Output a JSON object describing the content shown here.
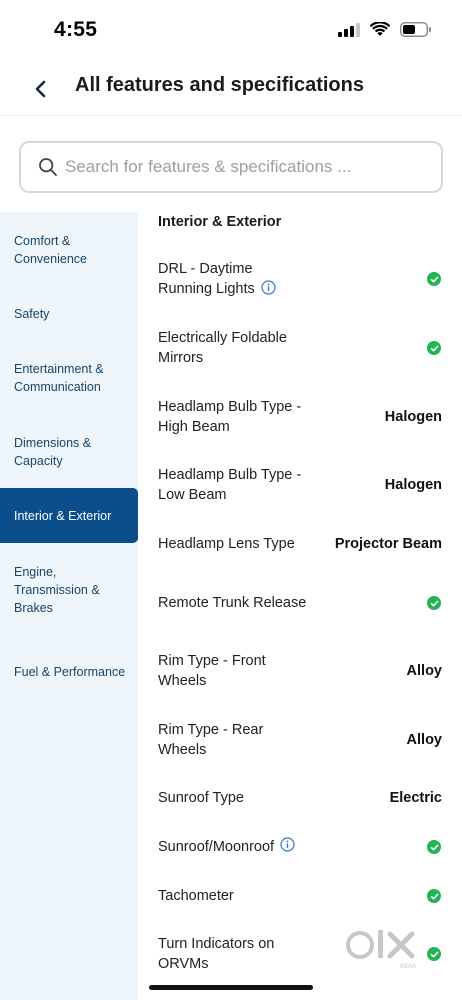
{
  "status_bar": {
    "time": "4:55"
  },
  "header": {
    "title": "All features and specifications"
  },
  "search": {
    "placeholder": "Search for features & specifications ..."
  },
  "sidebar": {
    "items": [
      {
        "label": "Comfort & Convenience",
        "active": false
      },
      {
        "label": "Safety",
        "active": false
      },
      {
        "label": "Entertainment & Communication",
        "active": false
      },
      {
        "label": "Dimensions & Capacity",
        "active": false
      },
      {
        "label": "Interior & Exterior",
        "active": true
      },
      {
        "label": "Engine, Transmission & Brakes",
        "active": false
      },
      {
        "label": "Fuel & Performance",
        "active": false
      }
    ]
  },
  "content": {
    "section_title": "Interior & Exterior",
    "rows": [
      {
        "label": "DRL - Daytime Running Lights",
        "value": "",
        "check": true,
        "info": true
      },
      {
        "label": "Electrically Foldable Mirrors",
        "value": "",
        "check": true,
        "info": false
      },
      {
        "label": "Headlamp Bulb Type - High Beam",
        "value": "Halogen",
        "check": false,
        "info": false
      },
      {
        "label": "Headlamp Bulb Type - Low Beam",
        "value": "Halogen",
        "check": false,
        "info": false
      },
      {
        "label": "Headlamp Lens Type",
        "value": "Projector Beam",
        "check": false,
        "info": false
      },
      {
        "label": "Remote Trunk Release",
        "value": "",
        "check": true,
        "info": false
      },
      {
        "label": "Rim Type - Front Wheels",
        "value": "Alloy",
        "check": false,
        "info": false
      },
      {
        "label": "Rim Type - Rear Wheels",
        "value": "Alloy",
        "check": false,
        "info": false
      },
      {
        "label": "Sunroof Type",
        "value": "Electric",
        "check": false,
        "info": false
      },
      {
        "label": "Sunroof/Moonroof",
        "value": "",
        "check": true,
        "info": true
      },
      {
        "label": "Tachometer",
        "value": "",
        "check": true,
        "info": false
      },
      {
        "label": "Turn Indicators on ORVMs",
        "value": "",
        "check": true,
        "info": false
      }
    ]
  },
  "watermark": {
    "text": "OLX",
    "subtext": "INDIA"
  },
  "colors": {
    "accent": "#0a4f8c",
    "sidebar_bg": "#eef5fb",
    "sidebar_text": "#17456b",
    "check_green": "#24b456",
    "info_blue": "#3478c8"
  },
  "icons": {
    "back": "chevron-left-icon",
    "search": "search-icon",
    "check": "check-circle-icon",
    "info": "info-icon",
    "signal": "cellular-signal-icon",
    "wifi": "wifi-icon",
    "battery": "battery-icon"
  }
}
